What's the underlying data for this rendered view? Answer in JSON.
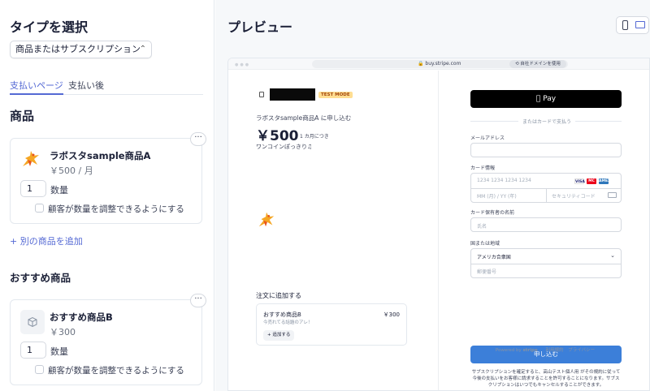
{
  "left": {
    "heading": "タイプを選択",
    "type_select": "商品またはサブスクリプション",
    "tabs": [
      {
        "label": "支払いページ",
        "active": true
      },
      {
        "label": "支払い後",
        "active": false
      }
    ],
    "products_heading": "商品",
    "products": [
      {
        "name": "ラボスタsample商品A",
        "price": "￥500 / 月",
        "quantity": "1",
        "quantity_label": "数量",
        "adjust_label": "顧客が数量を調整できるようにする",
        "more": "···"
      }
    ],
    "add_product": "+ 別の商品を追加",
    "recommended_heading": "おすすめ商品",
    "recommended": [
      {
        "name": "おすすめ商品B",
        "price": "￥300",
        "quantity": "1",
        "quantity_label": "数量",
        "adjust_label": "顧客が数量を調整できるようにする",
        "more": "···"
      }
    ]
  },
  "preview": {
    "heading": "プレビュー",
    "browser": {
      "url": "buy.stripe.com",
      "domain_button": "自社ドメインを使用"
    },
    "checkout_left": {
      "test_mode": "TEST MODE",
      "subscribe_title": "ラボスタsample商品A に申し込む",
      "price": "￥500",
      "per": "1 カ月につき",
      "description": "ワンコインぽっきり♫",
      "add_to_order": "注文に追加する",
      "upsell": {
        "name": "おすすめ商品B",
        "price": "￥300",
        "subtitle": "今売れてる話題のアレ！",
        "add_button": "+ 追加する"
      }
    },
    "checkout_right": {
      "apple_pay": "Pay",
      "or_card": "またはカードで支払う",
      "email_label": "メールアドレス",
      "card_label": "カード情報",
      "card_number_ph": "1234 1234 1234 1234",
      "card_exp_ph": "MM (月) / YY (年)",
      "card_cvc_ph": "セキュリティコード",
      "brands": [
        "VISA",
        "MC",
        "AMEX"
      ],
      "holder_label": "カード保有者の名前",
      "holder_ph": "氏名",
      "country_label": "国または地域",
      "country_value": "アメリカ合衆国",
      "zip_ph": "郵便番号",
      "submit": "申し込む",
      "legal": "サブスクリプションを確定すると、高山テスト個人用 がその規約に従って今後の支払いをお客様に請求することを許可することになります。サブスクリプションはいつでもキャンセルすることができます。",
      "powered_by": "Powered by",
      "stripe": "stripe",
      "terms": "利用規約",
      "privacy": "プライバシー"
    }
  },
  "colors": {
    "accent": "#5469d4",
    "submit": "#3c7fd9",
    "test_mode_bg": "#ffde92",
    "preview_bg": "#f6f8fa"
  }
}
